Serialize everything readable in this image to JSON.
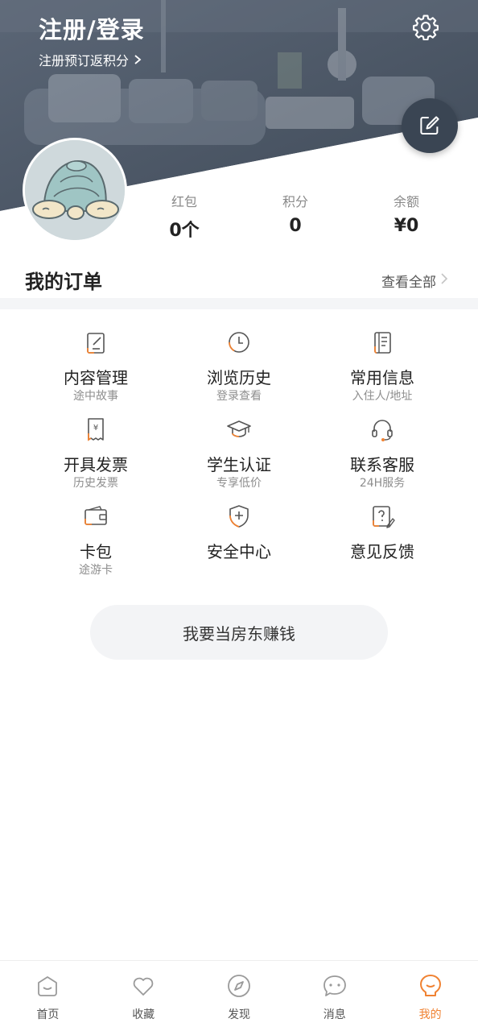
{
  "header": {
    "title": "注册/登录",
    "subtitle": "注册预订返积分"
  },
  "stats": [
    {
      "label": "红包",
      "value": "0个"
    },
    {
      "label": "积分",
      "value": "0"
    },
    {
      "label": "余额",
      "value": "¥0"
    }
  ],
  "orders": {
    "title": "我的订单",
    "view_all": "查看全部"
  },
  "services": [
    {
      "label": "内容管理",
      "sub": "途中故事",
      "icon": "content-manage-icon"
    },
    {
      "label": "浏览历史",
      "sub": "登录查看",
      "icon": "history-clock-icon"
    },
    {
      "label": "常用信息",
      "sub": "入住人/地址",
      "icon": "info-notebook-icon"
    },
    {
      "label": "开具发票",
      "sub": "历史发票",
      "icon": "invoice-icon"
    },
    {
      "label": "学生认证",
      "sub": "专享低价",
      "icon": "graduation-cap-icon"
    },
    {
      "label": "联系客服",
      "sub": "24H服务",
      "icon": "headset-icon"
    },
    {
      "label": "卡包",
      "sub": "途游卡",
      "icon": "wallet-icon"
    },
    {
      "label": "安全中心",
      "sub": "",
      "icon": "shield-icon"
    },
    {
      "label": "意见反馈",
      "sub": "",
      "icon": "feedback-icon"
    }
  ],
  "landlord_button": "我要当房东赚钱",
  "bottom_nav": [
    {
      "label": "首页",
      "icon": "home-icon",
      "active": false
    },
    {
      "label": "收藏",
      "icon": "heart-icon",
      "active": false
    },
    {
      "label": "发现",
      "icon": "compass-icon",
      "active": false
    },
    {
      "label": "消息",
      "icon": "chat-icon",
      "active": false
    },
    {
      "label": "我的",
      "icon": "profile-icon",
      "active": true
    }
  ],
  "colors": {
    "accent": "#f08232",
    "header_dark": "#3a4553"
  }
}
